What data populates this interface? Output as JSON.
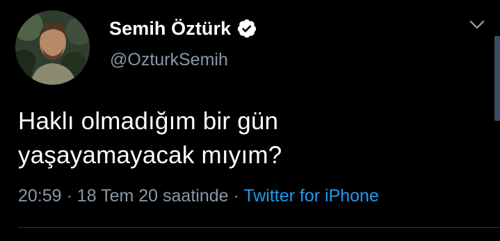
{
  "tweet": {
    "author": {
      "display_name": "Semih Öztürk",
      "handle": "@OzturkSemih",
      "verified": true,
      "avatar": "profile-photo"
    },
    "text_lines": [
      "Haklı olmadığım bir gün",
      "yaşayamayacak mıyım?"
    ],
    "time": "20:59",
    "separator": "·",
    "date": "18 Tem 20 saatinde",
    "source": "Twitter for iPhone"
  },
  "icons": {
    "verified": "verified-badge-icon",
    "menu": "chevron-down-icon"
  },
  "colors": {
    "background": "#000000",
    "secondary_text": "#8b98a5",
    "link": "#1d9bf0",
    "divider": "#2f3336"
  }
}
